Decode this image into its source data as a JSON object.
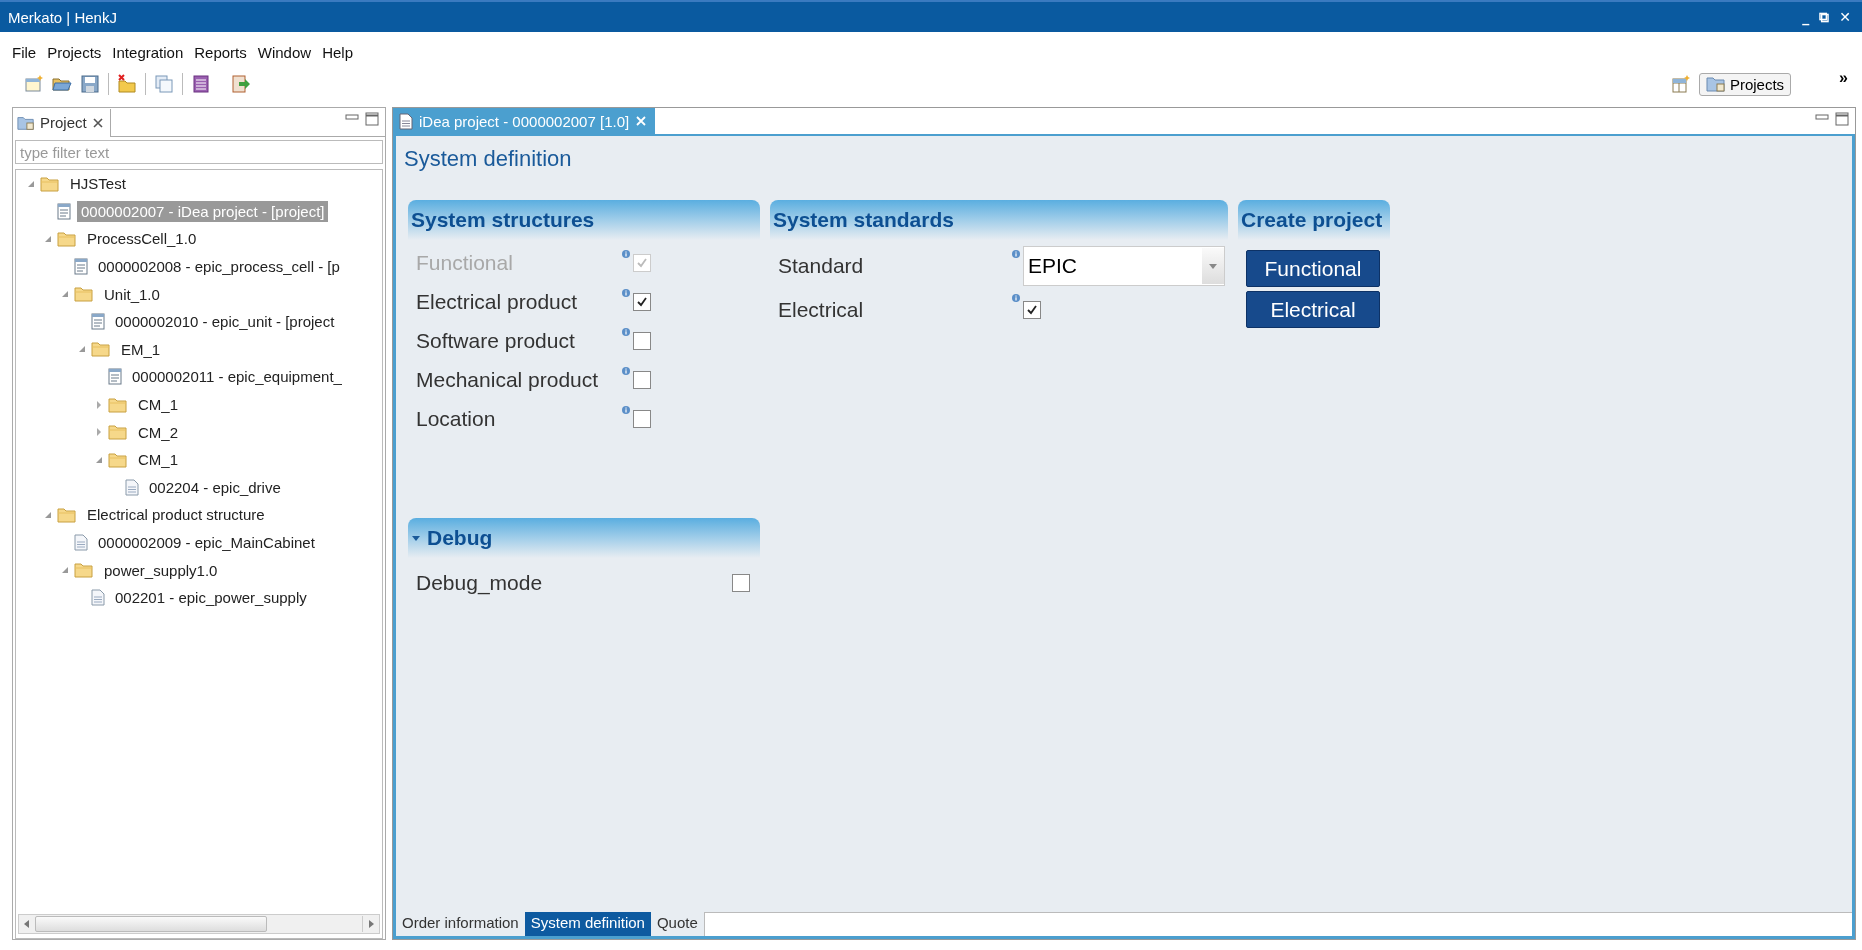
{
  "window": {
    "title": "Merkato | HenkJ",
    "controls": [
      "_",
      "⧉",
      "✕"
    ]
  },
  "menu": [
    "File",
    "Projects",
    "Integration",
    "Reports",
    "Window",
    "Help"
  ],
  "perspective": {
    "label": "Projects",
    "more": "»"
  },
  "project_view": {
    "tab": "Project",
    "filter_placeholder": "type filter text",
    "tree": [
      {
        "label": "HJSTest",
        "kind": "folder",
        "expanded": true,
        "selected": false,
        "children": [
          {
            "label": "0000002007 - iDea project - [project]",
            "kind": "project",
            "selected": true
          },
          {
            "label": "ProcessCell_1.0",
            "kind": "folder",
            "expanded": true,
            "selected": false,
            "children": [
              {
                "label": "0000002008 - epic_process_cell - [p",
                "kind": "project",
                "selected": false
              },
              {
                "label": "Unit_1.0",
                "kind": "folder",
                "expanded": true,
                "selected": false,
                "children": [
                  {
                    "label": "0000002010 - epic_unit - [project",
                    "kind": "project",
                    "selected": false
                  },
                  {
                    "label": "EM_1",
                    "kind": "folder",
                    "expanded": true,
                    "selected": false,
                    "children": [
                      {
                        "label": "0000002011 - epic_equipment_",
                        "kind": "project",
                        "selected": false
                      },
                      {
                        "label": "CM_1",
                        "kind": "folder",
                        "expanded": false,
                        "selected": false
                      },
                      {
                        "label": "CM_2",
                        "kind": "folder",
                        "expanded": false,
                        "selected": false
                      },
                      {
                        "label": "CM_1",
                        "kind": "folder",
                        "expanded": true,
                        "selected": false,
                        "children": [
                          {
                            "label": "002204 - epic_drive",
                            "kind": "file",
                            "selected": false
                          }
                        ]
                      }
                    ]
                  }
                ]
              }
            ]
          },
          {
            "label": "Electrical product structure",
            "kind": "folder",
            "expanded": true,
            "selected": false,
            "children": [
              {
                "label": "0000002009 - epic_MainCabinet",
                "kind": "file",
                "selected": false
              },
              {
                "label": "power_supply1.0",
                "kind": "folder",
                "expanded": true,
                "selected": false,
                "children": [
                  {
                    "label": "002201 - epic_power_supply",
                    "kind": "file",
                    "selected": false
                  }
                ]
              }
            ]
          }
        ]
      }
    ]
  },
  "editor": {
    "tab": "iDea project - 0000002007 [1.0]",
    "heading": "System definition",
    "structures": {
      "title": "System structures",
      "items": [
        {
          "label": "Functional",
          "checked": true,
          "disabled": true
        },
        {
          "label": "Electrical product",
          "checked": true,
          "disabled": false
        },
        {
          "label": "Software product",
          "checked": false,
          "disabled": false
        },
        {
          "label": "Mechanical product",
          "checked": false,
          "disabled": false
        },
        {
          "label": "Location",
          "checked": false,
          "disabled": false
        }
      ]
    },
    "standards": {
      "title": "System standards",
      "standard_label": "Standard",
      "standard_value": "EPIC",
      "electrical_label": "Electrical",
      "electrical_checked": true
    },
    "create": {
      "title": "Create project",
      "buttons": [
        "Functional",
        "Electrical"
      ]
    },
    "debug": {
      "title": "Debug",
      "expanded": true,
      "label": "Debug_mode",
      "checked": false
    },
    "pages": [
      {
        "label": "Order information",
        "selected": false
      },
      {
        "label": "System definition",
        "selected": true
      },
      {
        "label": "Quote",
        "selected": false
      }
    ]
  }
}
